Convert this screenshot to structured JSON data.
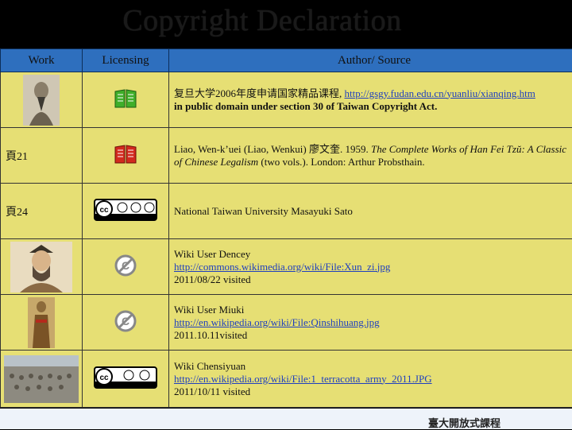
{
  "title": "Copyright Declaration",
  "headers": {
    "work": "Work",
    "licensing": "Licensing",
    "source": "Author/ Source"
  },
  "rows": [
    {
      "work": "",
      "source": [
        {
          "text": "复旦大学2006年度申请国家精品课程, ",
          "link": "http://gsgy.fudan.edu.cn/yuanliu/xianqing.htm"
        },
        {
          "text": "in public domain under section 30 of Taiwan Copyright Act.",
          "bold": true
        }
      ]
    },
    {
      "work": "頁21",
      "source": [
        {
          "text": "Liao, Wen-k’uei (Liao, Wenkui) 廖文奎. 1959. "
        },
        {
          "text": "The Complete Works of Han Fei Tzŭ: A Classic of Chinese Legalism",
          "italic": true
        },
        {
          "text": " (two vols.). London: Arthur Probsthain."
        }
      ]
    },
    {
      "work": "頁24",
      "source": [
        {
          "text": "National Taiwan University Masayuki Sato"
        }
      ]
    },
    {
      "work": "",
      "source": [
        {
          "text": "Wiki User Dencey"
        },
        {
          "link": "http://commons.wikimedia.org/wiki/File:Xun_zi.jpg"
        },
        {
          "text": "2011/08/22 visited"
        }
      ]
    },
    {
      "work": "",
      "source": [
        {
          "text": "Wiki User Miuki"
        },
        {
          "link": "http://en.wikipedia.org/wiki/File:Qinshihuang.jpg"
        },
        {
          "text": "2011.10.11visited"
        }
      ]
    },
    {
      "work": "",
      "source": [
        {
          "text": "Wiki Chensiyuan"
        },
        {
          "link": "http://en.wikipedia.org/wiki/File:1_terracotta_army_2011.JPG"
        },
        {
          "text": "2011/10/11 visited"
        }
      ]
    }
  ],
  "icons": [
    "green-book-icon",
    "red-book-icon",
    "cc-by-nc-sa-icon",
    "no-copyright-icon",
    "no-copyright-icon",
    "cc-by-sa-icon"
  ],
  "footer": {
    "label": "臺大開放式課程"
  },
  "colors": {
    "header": "#2e6fbe",
    "cell": "#e6df74",
    "link": "#1f3fbf"
  }
}
